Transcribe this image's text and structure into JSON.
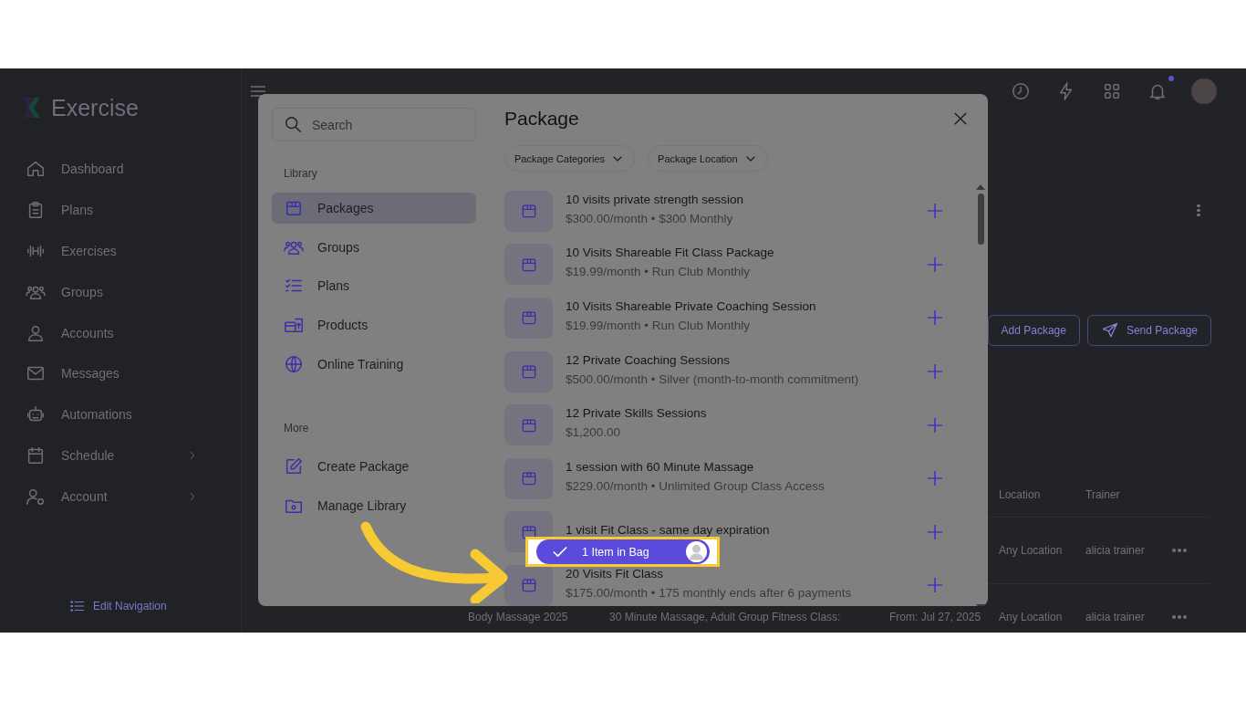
{
  "app": {
    "logo_text": "Exercise"
  },
  "sidebar": {
    "items": [
      {
        "label": "Dashboard",
        "has_submenu": false
      },
      {
        "label": "Plans",
        "has_submenu": false
      },
      {
        "label": "Exercises",
        "has_submenu": false
      },
      {
        "label": "Groups",
        "has_submenu": false
      },
      {
        "label": "Accounts",
        "has_submenu": false
      },
      {
        "label": "Messages",
        "has_submenu": false
      },
      {
        "label": "Automations",
        "has_submenu": false
      },
      {
        "label": "Schedule",
        "has_submenu": true
      },
      {
        "label": "Account",
        "has_submenu": true
      }
    ],
    "edit_navigation": "Edit Navigation"
  },
  "topbar": {
    "has_notification": true
  },
  "background": {
    "actions": [
      "Add Package",
      "Send Package"
    ],
    "table": {
      "columns": [
        "",
        "",
        "",
        "Location",
        "Trainer"
      ],
      "rows": [
        {
          "cells": [
            "",
            "",
            "",
            "Any Location",
            "alicia trainer"
          ]
        },
        {
          "cells": [
            "Body Massage 2025",
            "30 Minute Massage, Adult Group Fitness Class:",
            "From: Jul 27, 2025",
            "Any Location",
            "alicia trainer"
          ]
        }
      ]
    }
  },
  "modal": {
    "search": {
      "placeholder": "Search"
    },
    "library_heading": "Library",
    "library": [
      {
        "label": "Packages",
        "selected": true
      },
      {
        "label": "Groups",
        "selected": false
      },
      {
        "label": "Plans",
        "selected": false
      },
      {
        "label": "Products",
        "selected": false
      },
      {
        "label": "Online Training",
        "selected": false
      }
    ],
    "more_heading": "More",
    "more": [
      "Create Package",
      "Manage Library"
    ],
    "title": "Package",
    "filters": [
      "Package Categories",
      "Package Location"
    ],
    "packages": [
      {
        "title": "10 visits private strength session",
        "subtitle": "$300.00/month • $300 Monthly"
      },
      {
        "title": "10 Visits Shareable Fit Class Package",
        "subtitle": "$19.99/month • Run Club Monthly"
      },
      {
        "title": "10 Visits Shareable Private Coaching Session",
        "subtitle": "$19.99/month • Run Club Monthly"
      },
      {
        "title": "12 Private Coaching Sessions",
        "subtitle": "$500.00/month • Silver (month-to-month commitment)"
      },
      {
        "title": "12 Private Skills Sessions",
        "subtitle": "$1,200.00"
      },
      {
        "title": "1 session with 60 Minute Massage",
        "subtitle": "$229.00/month • Unlimited Group Class Access"
      },
      {
        "title": "1 visit Fit Class - same day expiration"
      },
      {
        "title": "20 Visits Fit Class",
        "subtitle": "$175.00/month • 175 monthly ends after 6 payments"
      }
    ]
  },
  "bag": {
    "label": "1 Item in Bag",
    "highlighted": true
  }
}
